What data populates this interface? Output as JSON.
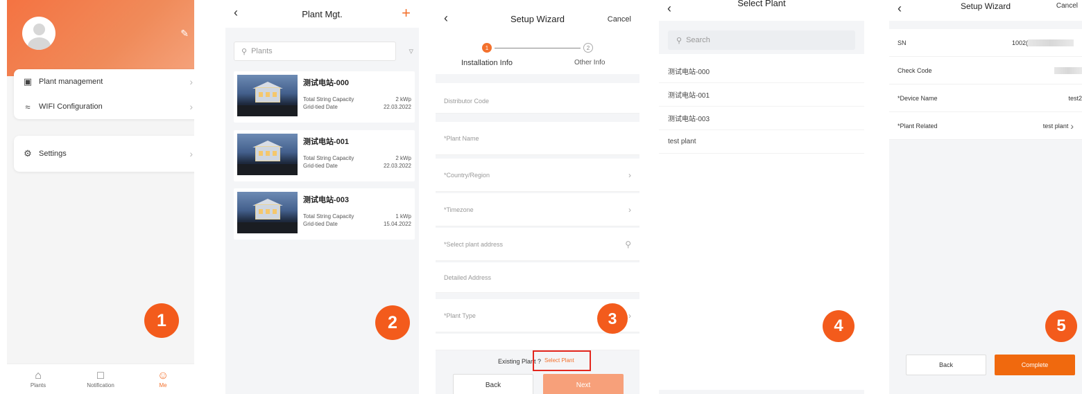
{
  "screen1": {
    "menu": [
      {
        "label": "Plant management",
        "icon": "plant-monitor-icon"
      },
      {
        "label": "WIFI Configuration",
        "icon": "wifi-icon"
      }
    ],
    "settings_label": "Settings",
    "tabs": [
      {
        "label": "Plants",
        "icon": "house-icon"
      },
      {
        "label": "Notification",
        "icon": "chat-icon"
      },
      {
        "label": "Me",
        "icon": "person-icon"
      }
    ],
    "badge": "1",
    "accent": "#f3712d"
  },
  "screen2": {
    "title": "Plant Mgt.",
    "search_placeholder": "Plants",
    "plants": [
      {
        "name": "测试电站-000",
        "capacity_label": "Total String Capacity",
        "capacity": "2 kWp",
        "date_label": "Grid-tied Date",
        "date": "22.03.2022"
      },
      {
        "name": "测试电站-001",
        "capacity_label": "Total String Capacity",
        "capacity": "2 kWp",
        "date_label": "Grid-tied Date",
        "date": "22.03.2022"
      },
      {
        "name": "测试电站-003",
        "capacity_label": "Total String Capacity",
        "capacity": "1 kWp",
        "date_label": "Grid-tied Date",
        "date": "15.04.2022"
      }
    ],
    "badge": "2"
  },
  "screen3": {
    "title": "Setup Wizard",
    "cancel": "Cancel",
    "step1_num": "1",
    "step1_label": "Installation Info",
    "step2_num": "2",
    "step2_label": "Other Info",
    "fields": [
      "Distributor Code",
      "*Plant Name",
      "*Country/Region",
      "*Timezone",
      "*Select plant address",
      "Detailed Address",
      "*Plant Type"
    ],
    "existing_prompt": "Existing Plant ?",
    "select_plant": "Select Plant",
    "back": "Back",
    "next": "Next",
    "badge": "3"
  },
  "screen4": {
    "title": "Select Plant",
    "search_placeholder": "Search",
    "options": [
      "测试电站-000",
      "测试电站-001",
      "测试电站-003",
      "test plant"
    ],
    "badge": "4"
  },
  "screen5": {
    "title": "Setup Wizard",
    "cancel": "Cancel",
    "sn_label": "SN",
    "sn_value": "1002(",
    "check_code_label": "Check Code",
    "device_name_label": "*Device Name",
    "device_name_value": "test2",
    "plant_related_label": "*Plant Related",
    "plant_related_value": "test plant",
    "back": "Back",
    "complete": "Complete",
    "badge": "5",
    "complete_color": "#f0690e"
  }
}
